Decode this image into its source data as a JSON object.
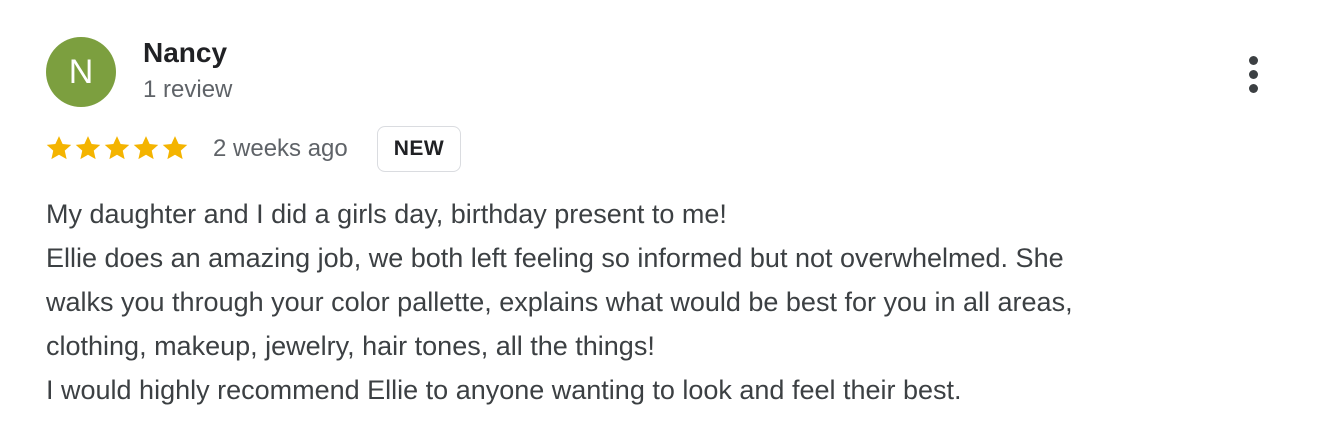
{
  "reviewer": {
    "initial": "N",
    "name": "Nancy",
    "review_count": "1 review",
    "avatar_color": "#7c9f3f"
  },
  "rating": {
    "stars": 5,
    "max_stars": 5,
    "star_color": "#f4b400",
    "date": "2 weeks ago",
    "badge": "NEW"
  },
  "more_options_icon": "more-vert-icon",
  "review_lines": [
    "My daughter and I did a girls day, birthday present to me!",
    "Ellie does an amazing job, we both left feeling so informed but not overwhelmed. She",
    "walks you through your color pallette, explains what would be best for you in all areas,",
    "clothing, makeup, jewelry, hair tones, all the things!",
    "I would highly recommend Ellie to anyone wanting to look and feel their best."
  ]
}
